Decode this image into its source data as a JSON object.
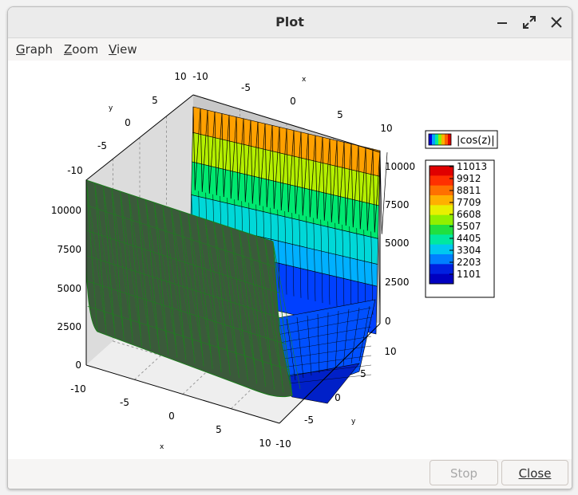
{
  "window": {
    "title": "Plot"
  },
  "menu": [
    {
      "label": "Graph"
    },
    {
      "label": "Zoom"
    },
    {
      "label": "View"
    }
  ],
  "footer": {
    "stop_label": "Stop",
    "close_label": "Close"
  },
  "chart_data": {
    "type": "surface3d",
    "function": "|cos(z)|",
    "xlabel": "x",
    "ylabel": "y",
    "x_ticks": [
      "-10",
      "-5",
      "0",
      "5",
      "10"
    ],
    "y_ticks": [
      "-10",
      "-5",
      "0",
      "5",
      "10"
    ],
    "z_ticks": [
      "0",
      "2500",
      "5000",
      "7500",
      "10000"
    ],
    "xlim": [
      -10,
      10
    ],
    "ylim": [
      -10,
      10
    ],
    "zlim": [
      0,
      11013
    ],
    "legend_label": "|cos(z)|",
    "colorbar_values": [
      "11013",
      "9912",
      "8811",
      "7709",
      "6608",
      "5507",
      "4405",
      "3304",
      "2203",
      "1101"
    ],
    "colorbar_colors": [
      "#e00000",
      "#ff6000",
      "#ffb000",
      "#e8f000",
      "#90f000",
      "#20e040",
      "#00e8a0",
      "#00c8f0",
      "#0060ff",
      "#0000d8"
    ],
    "legend_placement": "right"
  }
}
